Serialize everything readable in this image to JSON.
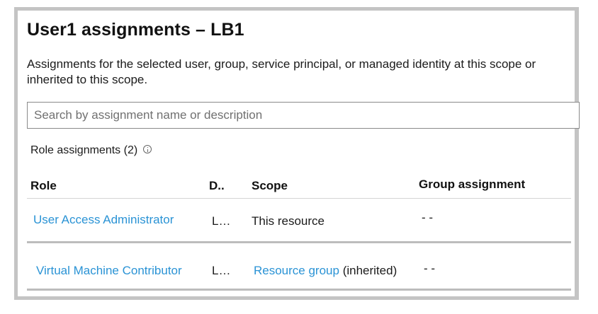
{
  "panel": {
    "title": "User1 assignments – LB1",
    "description": "Assignments for the selected user, group, service principal, or managed identity at this scope or inherited to this scope."
  },
  "search": {
    "placeholder": "Search by assignment name or description",
    "value": ""
  },
  "assignments": {
    "count_label": "Role assignments (2)",
    "info_icon": "info-icon",
    "columns": {
      "role": "Role",
      "description": "D..",
      "scope": "Scope",
      "group_assignment": "Group assignment"
    },
    "rows": [
      {
        "role": "User Access Administrator",
        "description": "L…",
        "scope_link": "",
        "scope_text": "This resource",
        "group_assignment": "- -"
      },
      {
        "role": "Virtual Machine Contributor",
        "description": "L…",
        "scope_link": "Resource group",
        "scope_text": " (inherited)",
        "group_assignment": "- -"
      }
    ]
  },
  "colors": {
    "link": "#2a93d5",
    "frame": "#c4c4c4"
  }
}
